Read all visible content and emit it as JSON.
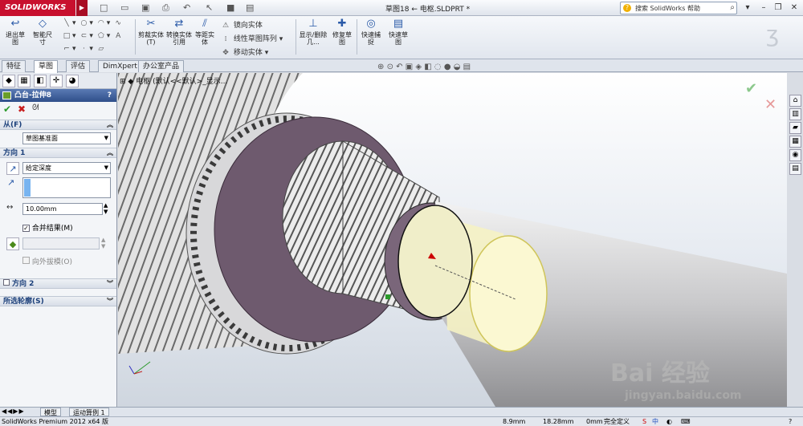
{
  "app": {
    "logo": "SOLIDWORKS",
    "doc_title": "草图18 ← 电枢.SLDPRT *"
  },
  "help": {
    "placeholder": "搜索 SolidWorks 帮助"
  },
  "commands": {
    "exit_sketch": "退出草图",
    "smart_dim": "智能尺寸",
    "trim": "剪裁实体(T)",
    "convert": "转换实体引用",
    "offset": "等距实体",
    "mirror": "镜向实体",
    "linear_pattern": "线性草图阵列",
    "move": "移动实体",
    "show_delete": "显示/删除几...",
    "repair": "修复草图",
    "quick_snaps": "快速捕捉",
    "rapid_sketch": "快速草图"
  },
  "tabs": [
    "特征",
    "草图",
    "评估",
    "DimXpert",
    "办公室产品"
  ],
  "active_tab": 1,
  "property_manager": {
    "title": "凸台-拉伸8",
    "help": "?",
    "from_section": "从(F)",
    "from_value": "草图基准面",
    "dir1_section": "方向 1",
    "end_condition": "给定深度",
    "depth": "10.00mm",
    "merge_label": "合并结果(M)",
    "merge_checked": true,
    "draft_label": "向外拔模(O)",
    "dir2_section": "方向 2",
    "contours_section": "所选轮廓(S)"
  },
  "tree": {
    "root": "电枢",
    "config": "(默认<<默认>_显示..."
  },
  "bottom_tabs": [
    "模型",
    "运动算例 1"
  ],
  "status": {
    "product": "SolidWorks Premium 2012 x64 版",
    "x": "8.9mm",
    "y": "18.28mm",
    "z": "0mm",
    "state": "完全定义"
  },
  "watermark": {
    "brand": "Bai 经验",
    "url": "jingyan.baidu.com"
  }
}
